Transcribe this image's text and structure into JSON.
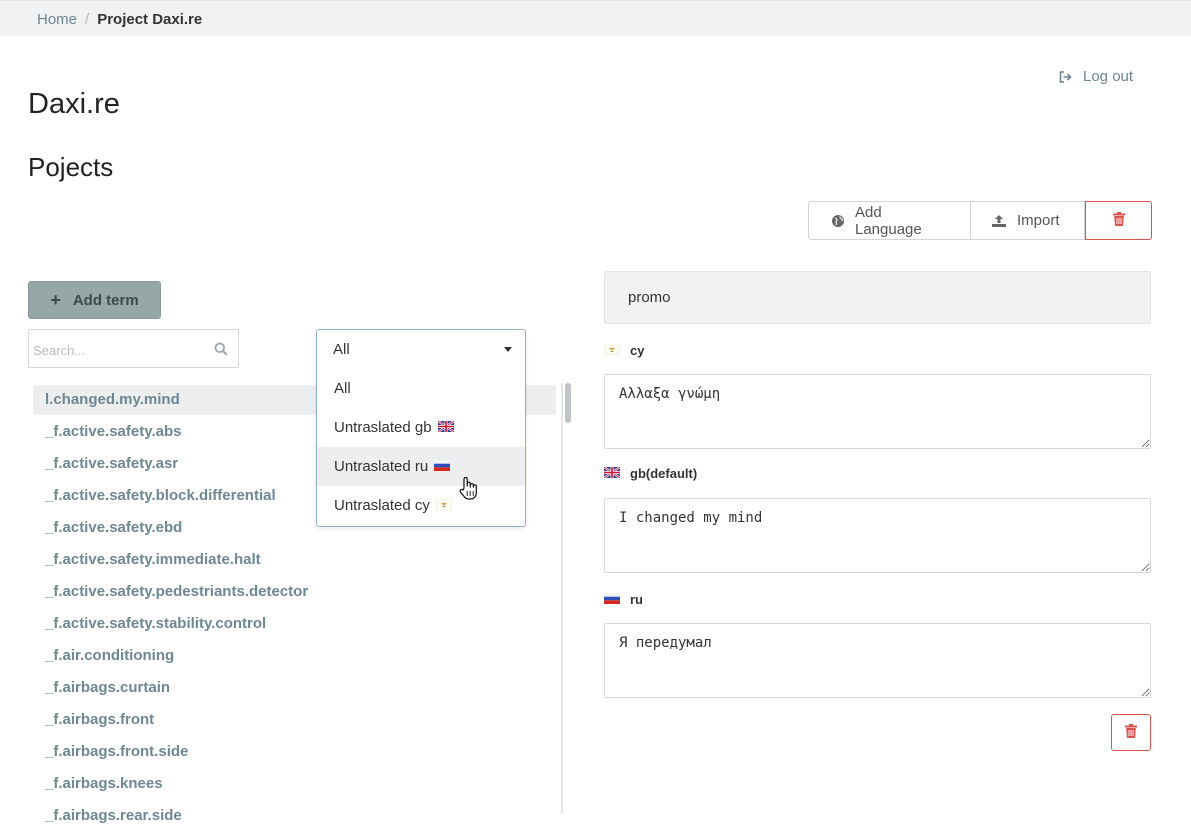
{
  "breadcrumb": {
    "home": "Home",
    "current": "Project Daxi.re"
  },
  "header": {
    "logout_label": "Log out",
    "app_title": "Daxi.re",
    "section_title": "Pojects"
  },
  "toolbar": {
    "add_language_label": "Add Language",
    "import_label": "Import",
    "delete_icon": "trash-icon"
  },
  "add_term_label": "Add term",
  "search": {
    "placeholder": "Search..."
  },
  "filter": {
    "selected": "All",
    "options": [
      {
        "label": "All",
        "flag": ""
      },
      {
        "label": "Untraslated gb",
        "flag": "gb"
      },
      {
        "label": "Untraslated ru",
        "flag": "ru"
      },
      {
        "label": "Untraslated cy",
        "flag": "cy"
      }
    ],
    "highlighted_index": 2
  },
  "terms": [
    "l.changed.my.mind",
    "_f.active.safety.abs",
    "_f.active.safety.asr",
    "_f.active.safety.block.differential",
    "_f.active.safety.ebd",
    "_f.active.safety.immediate.halt",
    "_f.active.safety.pedestriants.detector",
    "_f.active.safety.stability.control",
    "_f.air.conditioning",
    "_f.airbags.curtain",
    "_f.airbags.front",
    "_f.airbags.front.side",
    "_f.airbags.knees",
    "_f.airbags.rear.side"
  ],
  "editor": {
    "key": "promo",
    "translations": [
      {
        "code": "cy",
        "suffix": "",
        "text": "Αλλαξα γνώμη",
        "flag": "cy"
      },
      {
        "code": "gb",
        "suffix": " (default)",
        "text": "I changed my mind",
        "flag": "gb"
      },
      {
        "code": "ru",
        "suffix": "",
        "text": "Я передумал",
        "flag": "ru"
      }
    ]
  },
  "colors": {
    "link": "#6f8792",
    "danger": "#d9534f",
    "add_term_bg": "#97a6a6"
  }
}
